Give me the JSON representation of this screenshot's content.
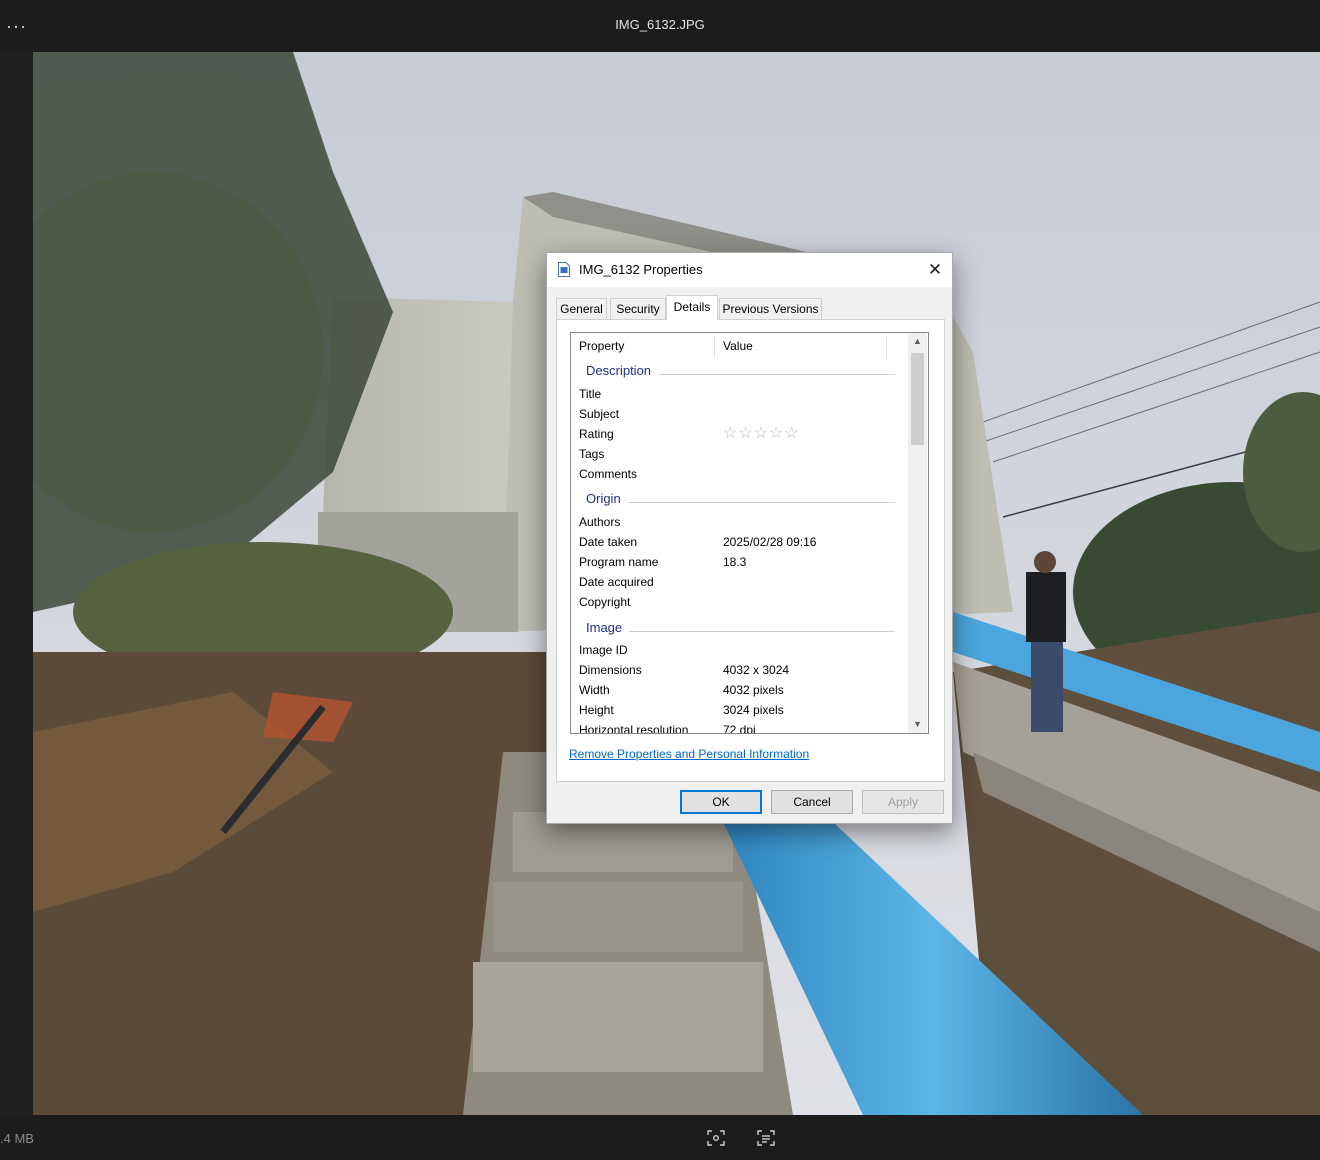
{
  "viewer": {
    "more_label": "...",
    "file_name": "IMG_6132.JPG",
    "file_size": ".4 MB",
    "bottom_icons": [
      "visual-search-icon",
      "text-extract-icon"
    ]
  },
  "dialog": {
    "title": "IMG_6132 Properties",
    "close_label": "✕",
    "tabs": [
      {
        "label": "General",
        "active": false
      },
      {
        "label": "Security",
        "active": false
      },
      {
        "label": "Details",
        "active": true
      },
      {
        "label": "Previous Versions",
        "active": false
      }
    ],
    "columns": {
      "property": "Property",
      "value": "Value"
    },
    "groups": {
      "description": {
        "name": "Description",
        "rows": [
          {
            "property": "Title",
            "value": ""
          },
          {
            "property": "Subject",
            "value": ""
          },
          {
            "property": "Rating",
            "value": "☆☆☆☆☆"
          },
          {
            "property": "Tags",
            "value": ""
          },
          {
            "property": "Comments",
            "value": ""
          }
        ]
      },
      "origin": {
        "name": "Origin",
        "rows": [
          {
            "property": "Authors",
            "value": ""
          },
          {
            "property": "Date taken",
            "value": "2025/02/28 09:16"
          },
          {
            "property": "Program name",
            "value": "18.3"
          },
          {
            "property": "Date acquired",
            "value": ""
          },
          {
            "property": "Copyright",
            "value": ""
          }
        ]
      },
      "image": {
        "name": "Image",
        "rows": [
          {
            "property": "Image ID",
            "value": ""
          },
          {
            "property": "Dimensions",
            "value": "4032 x 3024"
          },
          {
            "property": "Width",
            "value": "4032 pixels"
          },
          {
            "property": "Height",
            "value": "3024 pixels"
          },
          {
            "property": "Horizontal resolution",
            "value": "72 dpi"
          }
        ]
      }
    },
    "remove_link": "Remove Properties and Personal Information",
    "buttons": {
      "ok": "OK",
      "cancel": "Cancel",
      "apply": "Apply"
    },
    "rating_stars": 0
  }
}
